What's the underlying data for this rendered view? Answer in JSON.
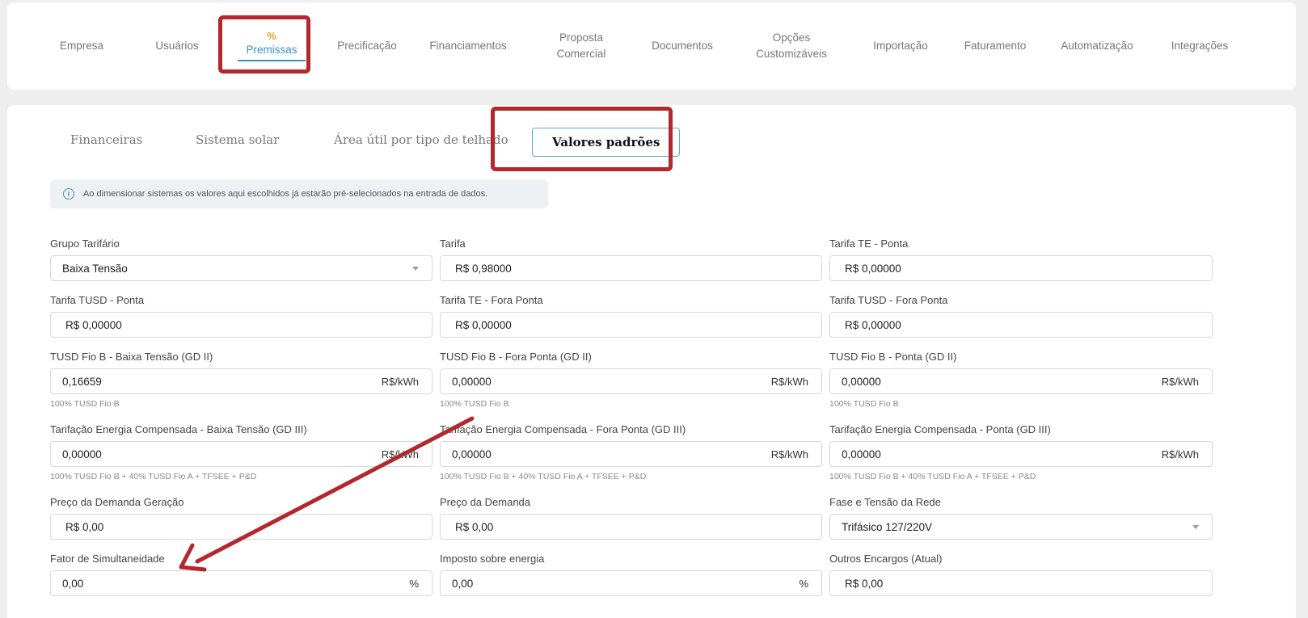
{
  "nav": {
    "items": [
      {
        "label": "Empresa"
      },
      {
        "label": "Usuários"
      },
      {
        "label": "Premissas",
        "icon": "%"
      },
      {
        "label": "Precificação"
      },
      {
        "label": "Financiamentos"
      },
      {
        "line1": "Proposta",
        "line2": "Comercial"
      },
      {
        "label": "Documentos"
      },
      {
        "line1": "Opções",
        "line2": "Customizáveis"
      },
      {
        "label": "Importação"
      },
      {
        "label": "Faturamento"
      },
      {
        "label": "Automatização"
      },
      {
        "label": "Integrações"
      }
    ]
  },
  "subtabs": [
    "Financeiras",
    "Sistema solar",
    "Área útil por tipo de telhado",
    "Valores padrões"
  ],
  "info": "Ao dimensionar sistemas os valores aqui escolhidos já estarão pré-selecionados na entrada de dados.",
  "fields": [
    {
      "label": "Grupo Tarifário",
      "value": "Baixa Tensão",
      "type": "select"
    },
    {
      "label": "Tarifa",
      "value": "R$ 0,98000"
    },
    {
      "label": "Tarifa TE - Ponta",
      "value": "R$ 0,00000"
    },
    {
      "label": "Tarifa TUSD - Ponta",
      "value": "R$ 0,00000"
    },
    {
      "label": "Tarifa TE - Fora Ponta",
      "value": "R$ 0,00000"
    },
    {
      "label": "Tarifa TUSD - Fora Ponta",
      "value": "R$ 0,00000"
    },
    {
      "label": "TUSD Fio B - Baixa Tensão (GD II)",
      "value": "0,16659",
      "suffix": "R$/kWh",
      "hint": "100% TUSD Fio B"
    },
    {
      "label": "TUSD Fio B - Fora Ponta (GD II)",
      "value": "0,00000",
      "suffix": "R$/kWh",
      "hint": "100% TUSD Fio B"
    },
    {
      "label": "TUSD Fio B - Ponta (GD II)",
      "value": "0,00000",
      "suffix": "R$/kWh",
      "hint": "100% TUSD Fio B"
    },
    {
      "label": "Tarifação Energia Compensada - Baixa Tensão (GD III)",
      "value": "0,00000",
      "suffix": "R$/kWh",
      "hint": "100% TUSD Fio B + 40% TUSD Fio A + TFSEE + P&D"
    },
    {
      "label": "Tarifação Energia Compensada - Fora Ponta (GD III)",
      "value": "0,00000",
      "suffix": "R$/kWh",
      "hint": "100% TUSD Fio B + 40% TUSD Fio A + TFSEE + P&D"
    },
    {
      "label": "Tarifação Energia Compensada - Ponta (GD III)",
      "value": "0,00000",
      "suffix": "R$/kWh",
      "hint": "100% TUSD Fio B + 40% TUSD Fio A + TFSEE + P&D"
    },
    {
      "label": "Preço da Demanda Geração",
      "value": "R$ 0,00"
    },
    {
      "label": "Preço da Demanda",
      "value": "R$ 0,00"
    },
    {
      "label": "Fase e Tensão da Rede",
      "value": "Trifásico 127/220V",
      "type": "select"
    },
    {
      "label": "Fator de Simultaneidade",
      "value": "0,00",
      "suffix": "%"
    },
    {
      "label": "Imposto sobre energia",
      "value": "0,00",
      "suffix": "%"
    },
    {
      "label": "Outros Encargos (Atual)",
      "value": "R$ 0,00"
    }
  ],
  "colors": {
    "accent": "#3a8fc9",
    "highlight": "#b3272d",
    "percent_icon": "#e79a2e"
  }
}
